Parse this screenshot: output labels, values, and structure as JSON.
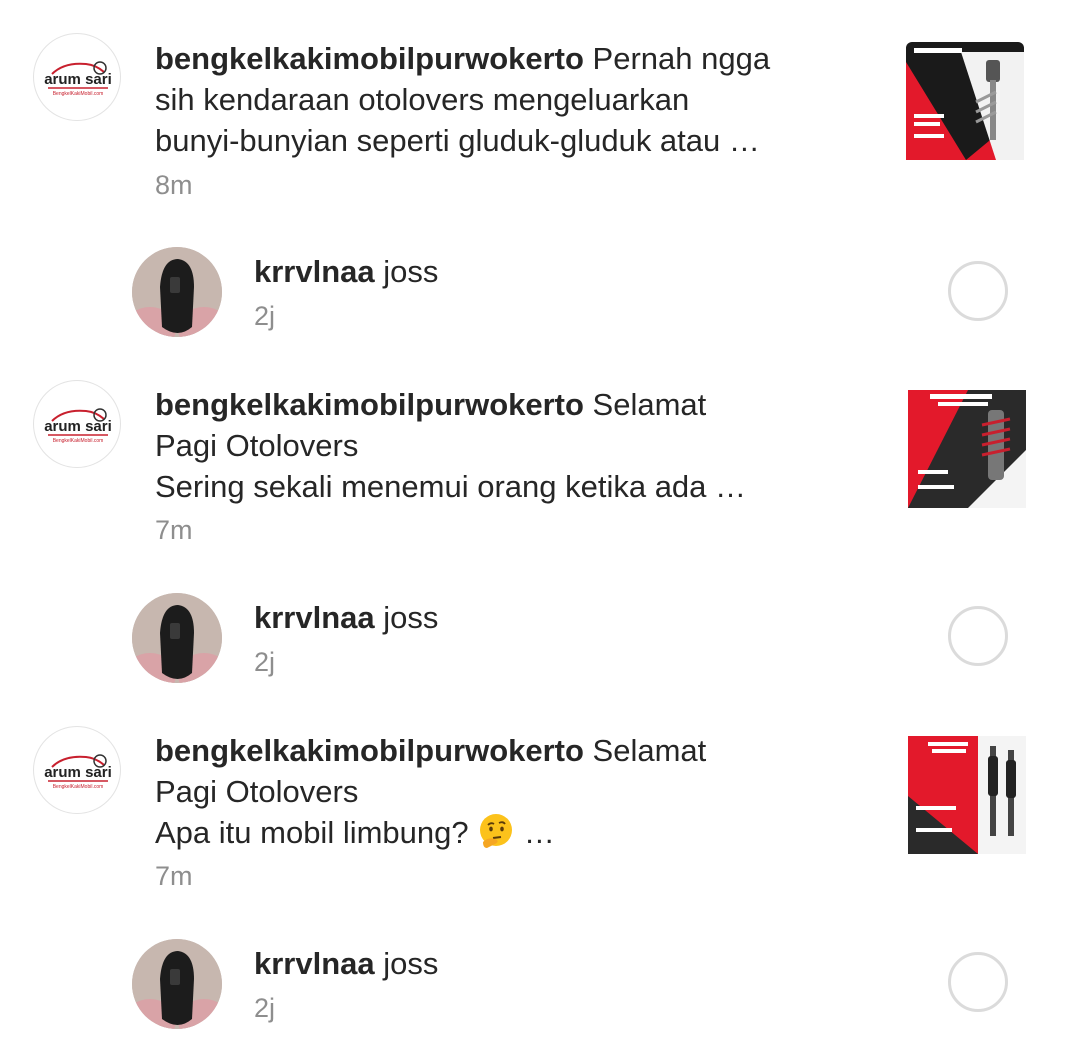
{
  "notifications": [
    {
      "type": "post",
      "avatar_icon": "arum-sari-logo",
      "logo_text": "arum sari",
      "logo_subtext": "BengkelKakiMobil.com",
      "username": "bengkelkakimobilpurwokerto",
      "lines": [
        " Pernah ngga",
        "sih kendaraan otolovers mengeluarkan",
        "bunyi-bunyian seperti gluduk-gluduk atau …"
      ],
      "time": "8m",
      "thumbnail_icon": "shock-absorber-promo-thumbnail"
    },
    {
      "type": "comment",
      "avatar_icon": "user-photo",
      "username": "krrvlnaa",
      "text": " joss",
      "time": "2j"
    },
    {
      "type": "post",
      "avatar_icon": "arum-sari-logo",
      "logo_text": "arum sari",
      "logo_subtext": "BengkelKakiMobil.com",
      "username": "bengkelkakimobilpurwokerto",
      "lines": [
        " Selamat",
        "Pagi Otolovers",
        "Sering sekali menemui orang ketika ada …"
      ],
      "time": "7m",
      "thumbnail_icon": "suspension-promo-thumbnail"
    },
    {
      "type": "comment",
      "avatar_icon": "user-photo",
      "username": "krrvlnaa",
      "text": " joss",
      "time": "2j"
    },
    {
      "type": "post",
      "avatar_icon": "arum-sari-logo",
      "logo_text": "arum sari",
      "logo_subtext": "BengkelKakiMobil.com",
      "username": "bengkelkakimobilpurwokerto",
      "lines": [
        " Selamat",
        "Pagi Otolovers",
        "Apa itu mobil limbung? ",
        " …"
      ],
      "emoji": "thinking-face",
      "time": "7m",
      "thumbnail_icon": "mobil-limbung-promo-thumbnail"
    },
    {
      "type": "comment",
      "avatar_icon": "user-photo",
      "username": "krrvlnaa",
      "text": " joss",
      "time": "2j"
    }
  ],
  "colors": {
    "text": "#262626",
    "secondary": "#8e8e8e",
    "brand_red": "#e3192b",
    "circle_border": "#dbdbdb"
  }
}
